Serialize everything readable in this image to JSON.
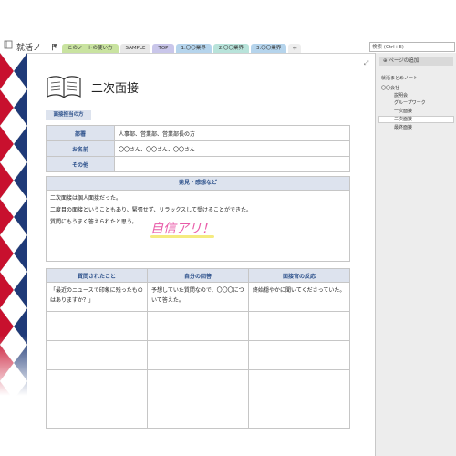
{
  "notebook": {
    "title": "就活ノート",
    "dropdown_glyph": "▼"
  },
  "tabs": [
    {
      "label": "このノートの使い方",
      "color": "#c9e3a0"
    },
    {
      "label": "SAMPLE",
      "color": "#e8e8e8"
    },
    {
      "label": "TOP",
      "color": "#c9c6ea"
    },
    {
      "label": "1.〇〇業界",
      "color": "#b5d4ec"
    },
    {
      "label": "2.〇〇業界",
      "color": "#b8e3da"
    },
    {
      "label": "3.〇〇業界",
      "color": "#b5d4ec"
    }
  ],
  "tab_add": "+",
  "search": {
    "placeholder": "検索 (Ctrl+E)"
  },
  "expand_glyph": "⤢",
  "page_panel": {
    "add_page_label": "⊕ ページの追加",
    "items": [
      {
        "label": "就活まとめノート",
        "indent": 0,
        "selected": false
      },
      {
        "label": "〇〇会社",
        "indent": 0,
        "selected": false
      },
      {
        "label": "説明会",
        "indent": 1,
        "selected": false
      },
      {
        "label": "グループワーク",
        "indent": 1,
        "selected": false
      },
      {
        "label": "一次面接",
        "indent": 1,
        "selected": false
      },
      {
        "label": "二次面接",
        "indent": 1,
        "selected": true
      },
      {
        "label": "最終面接",
        "indent": 1,
        "selected": false
      }
    ]
  },
  "page": {
    "title": "二次面接",
    "interviewer_section": {
      "label": "面接担当の方",
      "rows": [
        {
          "key": "部署",
          "value": "人事部、営業部、営業部長の方"
        },
        {
          "key": "お名前",
          "value": "〇〇さん、〇〇さん、〇〇さん"
        },
        {
          "key": "その他",
          "value": ""
        }
      ]
    },
    "impressions": {
      "header": "発見・感想など",
      "lines": [
        "二次面接は個人面接だった。",
        "二度目の面接ということもあり、緊張せず、リラックスして受けることができた。",
        "質問にもうまく答えられたと思う。"
      ],
      "handwritten": "自信アリ！"
    },
    "qa_table": {
      "headers": [
        "質問されたこと",
        "自分の回答",
        "面接官の反応"
      ],
      "rows": [
        [
          "「最近のニュースで印象に残ったものはありますか？」",
          "予想していた質問なので、〇〇〇について答えた。",
          "終始穏やかに聞いてくださっていた。"
        ],
        [
          "",
          "",
          ""
        ],
        [
          "",
          "",
          ""
        ],
        [
          "",
          "",
          ""
        ],
        [
          "",
          "",
          ""
        ]
      ]
    }
  },
  "colors": {
    "argyle_red": "#c8102e",
    "argyle_navy": "#1f3a78",
    "header_bg": "#dde3ee",
    "header_text": "#2a4f8a",
    "handwriting": "#e85aa8",
    "highlight": "#f3e86a"
  }
}
